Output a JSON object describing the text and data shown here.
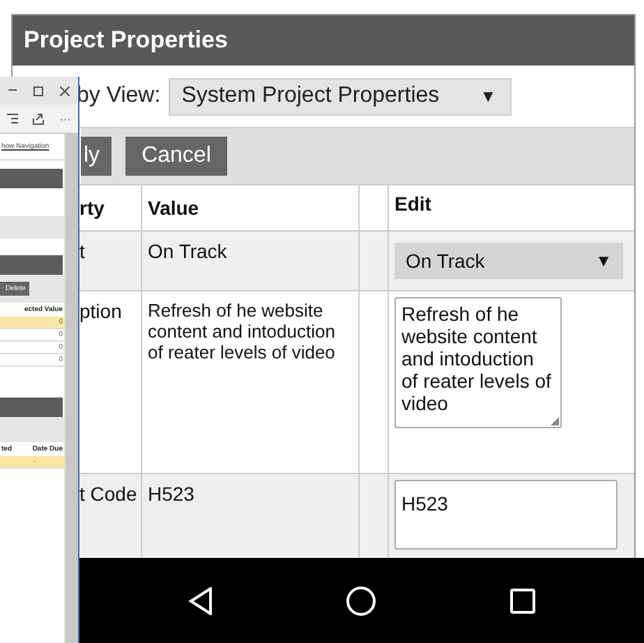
{
  "dialog": {
    "title": "Project Properties",
    "view": {
      "label": "by View:",
      "value": "System Project Properties",
      "caret": "▼"
    },
    "buttons": [
      "ly",
      "Cancel"
    ],
    "table": {
      "columns": [
        "rty",
        "Value",
        "Edit"
      ],
      "rows": [
        {
          "property": "t",
          "value": "On Track",
          "edit": {
            "kind": "select",
            "value": "On Track",
            "caret": "▼"
          }
        },
        {
          "property": "ption",
          "value": "Refresh of he website content and intoduction of reater levels of video",
          "edit": {
            "kind": "textarea",
            "value": "Refresh of he website content and intoduction of reater levels of video"
          }
        },
        {
          "property": "t Code",
          "value": "H523",
          "edit": {
            "kind": "input",
            "value": "H523"
          }
        }
      ]
    }
  },
  "browser_window": {
    "menu": "···",
    "link": "how Navigation",
    "delete_button": "Delete",
    "values_table": {
      "column": "ected Value",
      "rows": [
        {
          "value": "0",
          "highlighted": true
        },
        {
          "value": "0",
          "highlighted": false
        },
        {
          "value": "0",
          "highlighted": false
        },
        {
          "value": "0",
          "highlighted": false
        }
      ]
    },
    "tasks_table": {
      "columns": [
        "ted",
        "Date Due"
      ],
      "rows": [
        {
          "date_due": "-",
          "highlighted": true
        }
      ]
    }
  }
}
